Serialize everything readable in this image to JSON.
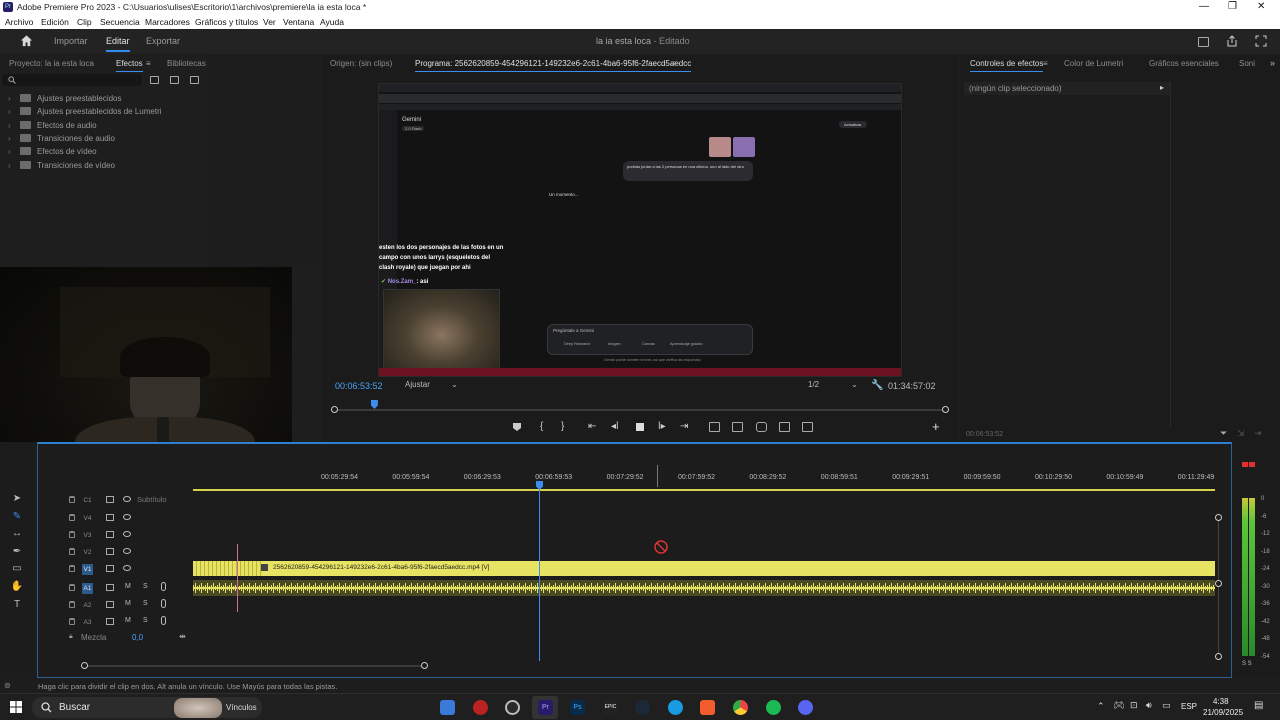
{
  "title": "Adobe Premiere Pro 2023 - C:\\Usuarios\\ulises\\Escritorio\\1\\archivos\\premiere\\la ia esta loca *",
  "app_badge": "Pr",
  "window_controls": [
    "—",
    "❐",
    "✕"
  ],
  "menu": [
    "Archivo",
    "Edición",
    "Clip",
    "Secuencia",
    "Marcadores",
    "Gráficos y títulos",
    "Ver",
    "Ventana",
    "Ayuda"
  ],
  "workspace": {
    "tabs": [
      "Importar",
      "Editar",
      "Exportar"
    ],
    "active": "Editar",
    "project_title": "la ia esta loca",
    "project_status": "- Editado"
  },
  "project_panel": {
    "tabs": [
      "Proyecto: la ia esta loca",
      "Efectos",
      "Bibliotecas"
    ],
    "active": "Efectos",
    "items": [
      "Ajustes preestablecidos",
      "Ajustes preestablecidos de Lumetri",
      "Efectos de audio",
      "Transiciones de audio",
      "Efectos de vídeo",
      "Transiciones de vídeo"
    ]
  },
  "source_tab": "Origen: (sin clips)",
  "program": {
    "tab": "Programa: 2562620859-454296121-149232e6-2c61-4ba6-95f6-2faecd5aedcc",
    "timecode": "00:06:53:52",
    "fit": "Ajustar",
    "resolution": "1/2",
    "duration": "01:34:57:02",
    "playhead_fraction": 0.066
  },
  "preview": {
    "app_name": "Gemini",
    "model": "2.0 Flash",
    "update_btn": "Actualizar",
    "user_message": "podrias juntar a las 2 personas en una oficina, uno al lado del otro",
    "loading": "Un momento...",
    "chat_msg": "esten los dos personajes de las fotos en un campo con unos larrys (esqueletos del clash royale) que juegan por ahi",
    "chat_user": "Nos.Zam_",
    "chat_reply": ": asi",
    "input_placeholder": "Pregúntale a Gemini",
    "chips": [
      "Deep Research",
      "Imagen",
      "Canvas",
      "Aprendizaje guiado"
    ],
    "disclaimer": "Gemini puede cometer errores, así que verifica las respuestas"
  },
  "effects_panel": {
    "tabs": [
      "Controles de efectos",
      "Color de Lumetri",
      "Gráficos esenciales",
      "Soni"
    ],
    "active": "Controles de efectos",
    "empty_text": "(ningún clip seleccionado)",
    "timecode": "00:06:53:52"
  },
  "timeline": {
    "ruler": [
      "00:05:29:54",
      "00:05:59:54",
      "00:06:29:53",
      "00:06:59:53",
      "00:07:29:52",
      "00:07:59:52",
      "00:08:29:52",
      "00:08:59:51",
      "00:09:29:51",
      "00:09:59:50",
      "00:10:29:50",
      "00:10:59:49",
      "00:11:29:49"
    ],
    "tracks": [
      {
        "name": "C1",
        "label": "Subtítulo",
        "type": "caption"
      },
      {
        "name": "V4",
        "type": "video"
      },
      {
        "name": "V3",
        "type": "video"
      },
      {
        "name": "V2",
        "type": "video"
      },
      {
        "name": "V1",
        "type": "video",
        "targeted": true
      },
      {
        "name": "A1",
        "type": "audio",
        "targeted": true
      },
      {
        "name": "A2",
        "type": "audio"
      },
      {
        "name": "A3",
        "type": "audio"
      }
    ],
    "mix_label": "Mezcla",
    "mix_value": "0,0",
    "clip_name": "2562620859-454296121-149232e6-2c61-4ba6-95f6-2faecd5aedcc.mp4 [V]",
    "track_letters": {
      "mute": "M",
      "solo": "S"
    }
  },
  "meter_labels": [
    "0",
    "-6",
    "-12",
    "-18",
    "-24",
    "-30",
    "-36",
    "-42",
    "-48",
    "-54"
  ],
  "meter_solo": "S S",
  "status": "Haga clic para dividir el clip en dos. Alt anula un vínculo. Use Mayús para todas las pistas.",
  "taskbar": {
    "search": "Buscar",
    "widget": "Vínculos",
    "lang": "ESP",
    "time": "4:38",
    "date": "21/09/2025"
  },
  "colors": {
    "accent": "#2f8cf0",
    "clip": "#e8e463",
    "bg": "#1d1d1d"
  }
}
